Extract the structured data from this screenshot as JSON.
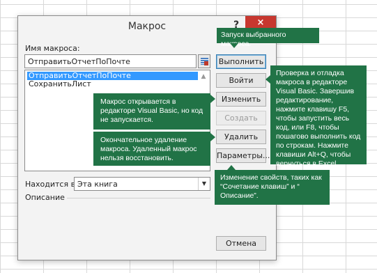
{
  "dialog": {
    "title": "Макрос",
    "help_label": "?",
    "close_label": "×",
    "macro_name_label": "Имя макроса:",
    "macro_name_value": "ОтправитьОтчетПоПочте",
    "macros": [
      "ОтправитьОтчетПоПочте",
      "СохранитьЛист"
    ],
    "location_label": "Находится в:",
    "location_value": "Эта книга",
    "description_label": "Описание",
    "buttons": {
      "run": "Выполнить",
      "step_into": "Войти",
      "edit": "Изменить",
      "create": "Создать",
      "delete": "Удалить",
      "options": "Параметры...",
      "cancel": "Отмена"
    }
  },
  "callouts": {
    "run": "Запуск выбранного макроса.",
    "step_into": "Проверка и отладка макроса в редакторе Visual Basic. Завершив редактирование, нажмите клавишу F5, чтобы запустить весь код, или F8, чтобы пошагово выполнить код по строкам. Нажмите клавиши Alt+Q, чтобы вернуться в Excel.",
    "edit": "Макрос открывается в редакторе Visual Basic, но код не запускается.",
    "delete": "Окончательное удаление макроса. Удаленный макрос нельзя восстановить.",
    "options": "Изменение свойств, таких как “Сочетание клавиш” и “ Описание”."
  }
}
